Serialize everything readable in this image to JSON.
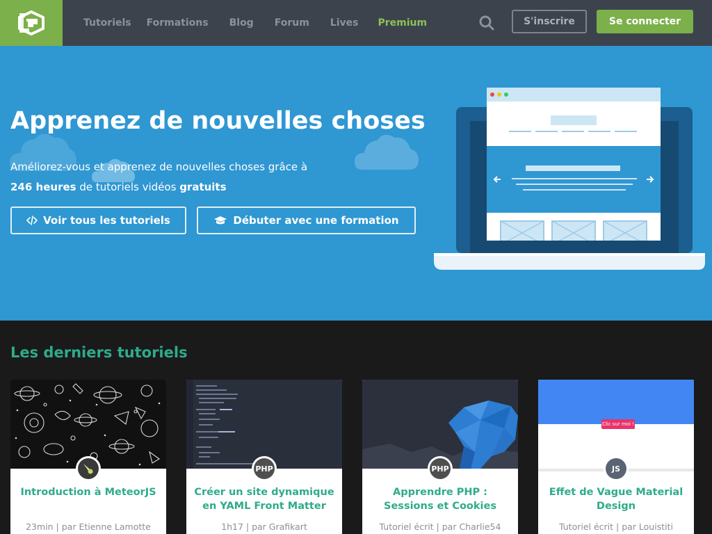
{
  "header": {
    "nav": [
      {
        "label": "Tutoriels",
        "premium": false
      },
      {
        "label": "Formations",
        "premium": false
      },
      {
        "label": "Blog",
        "premium": false
      },
      {
        "label": "Forum",
        "premium": false
      },
      {
        "label": "Lives",
        "premium": false
      },
      {
        "label": "Premium",
        "premium": true
      }
    ],
    "register_label": "S'inscrire",
    "login_label": "Se connecter"
  },
  "hero": {
    "title": "Apprenez de nouvelles choses",
    "line1": "Améliorez-vous et apprenez de nouvelles choses grâce à",
    "hours": "246 heures",
    "line2_mid": " de tutoriels vidéos ",
    "free": "gratuits",
    "btn_tutorials": "Voir tous les tutoriels",
    "btn_formation": "Débuter avec une formation",
    "mock_button_text": "Clic sur moi !"
  },
  "section": {
    "title": "Les derniers tutoriels"
  },
  "cards": [
    {
      "title": "Introduction à MeteorJS",
      "meta": "23min | par Etienne Lamotte",
      "tech": "meteor-icon",
      "badge_text": "",
      "badge_color": "#3a3a3a"
    },
    {
      "title": "Créer un site dynamique en YAML Front Matter",
      "meta": "1h17 | par Grafikart",
      "tech": "php-icon",
      "badge_text": "PHP",
      "badge_color": "#4f4f4f"
    },
    {
      "title": "Apprendre PHP : Sessions et Cookies",
      "meta": "Tutoriel écrit | par Charlie54",
      "tech": "php-icon",
      "badge_text": "PHP",
      "badge_color": "#4f4f4f"
    },
    {
      "title": "Effet de Vague Material Design",
      "meta": "Tutoriel écrit | par Louistiti",
      "tech": "js-icon",
      "badge_text": "JS",
      "badge_color": "#5a6472"
    }
  ],
  "colors": {
    "brand_green": "#7bb04a",
    "hero_blue": "#2f97d2",
    "accent_teal": "#2eab8a",
    "header_bg": "#3d434d"
  }
}
